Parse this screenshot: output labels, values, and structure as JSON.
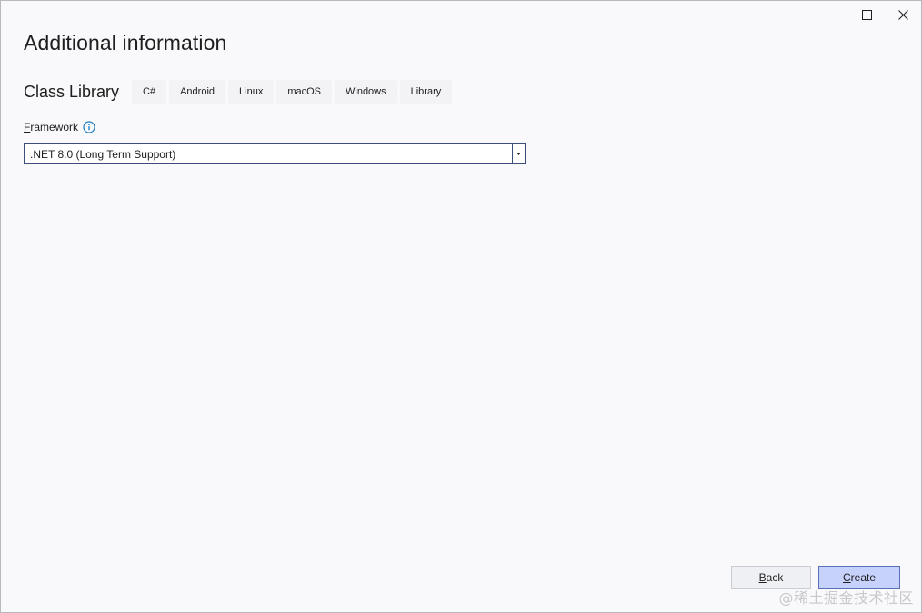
{
  "dialog": {
    "title": "Additional information"
  },
  "template": {
    "name": "Class Library",
    "tags": [
      "C#",
      "Android",
      "Linux",
      "macOS",
      "Windows",
      "Library"
    ]
  },
  "framework": {
    "label_access_key": "F",
    "label_rest": "ramework",
    "selected_value": ".NET 8.0 (Long Term Support)"
  },
  "buttons": {
    "back_access_key": "B",
    "back_rest": "ack",
    "create_access_key": "C",
    "create_rest": "reate"
  },
  "watermark": {
    "text": "@稀土掘金技术社区"
  },
  "icons": {
    "maximize": "maximize-icon",
    "close": "close-icon",
    "info": "info-icon",
    "dropdown": "chevron-down-icon"
  },
  "colors": {
    "accent": "#1b7ac2",
    "primary_button": "#c7d2fc",
    "primary_button_border": "#5a6fbc",
    "input_border": "#3c4f7a"
  }
}
